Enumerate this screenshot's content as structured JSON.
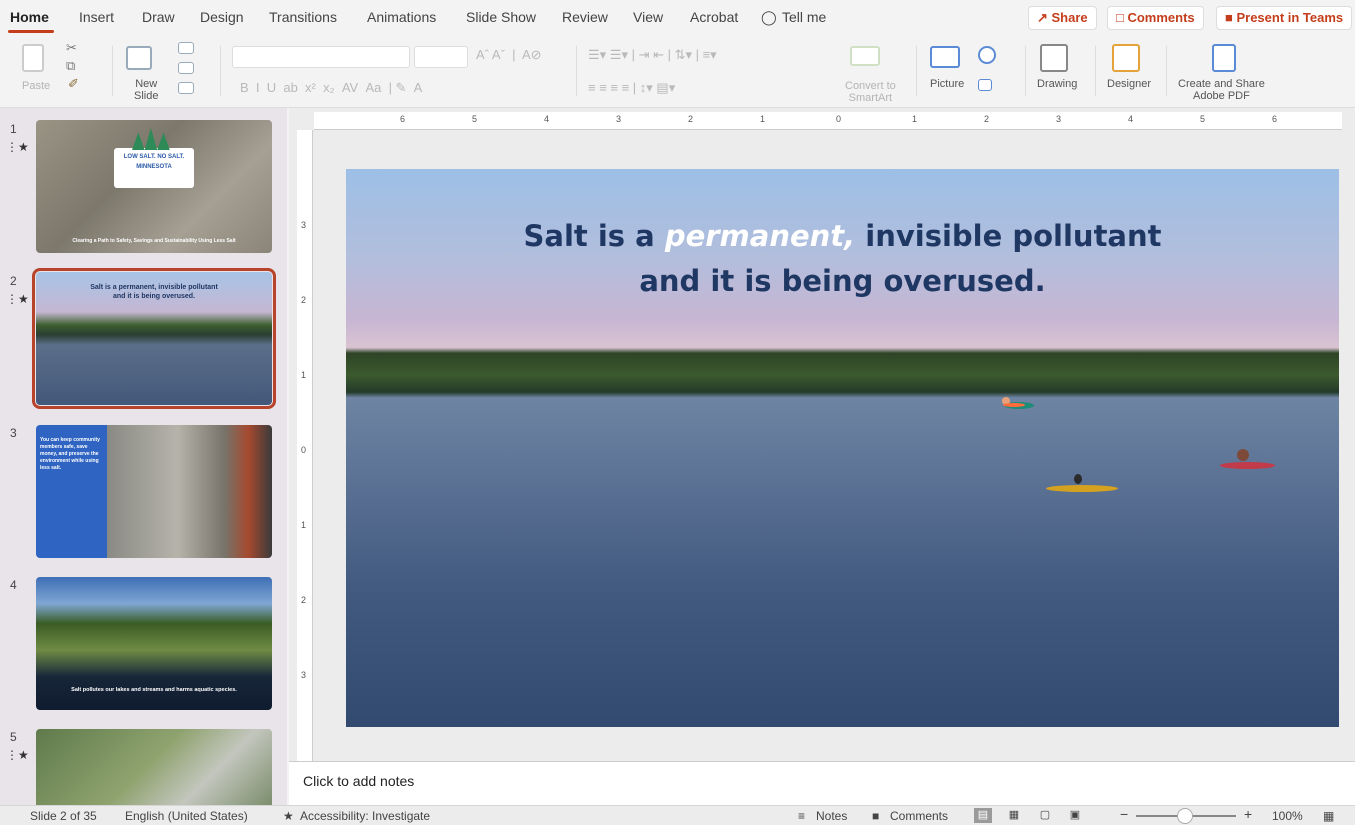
{
  "tabs": [
    "Home",
    "Insert",
    "Draw",
    "Design",
    "Transitions",
    "Animations",
    "Slide Show",
    "Review",
    "View",
    "Acrobat",
    "Tell me"
  ],
  "top_buttons": {
    "share": "Share",
    "comments": "Comments",
    "present": "Present in Teams"
  },
  "ribbon": {
    "paste": "Paste",
    "new_slide_line1": "New",
    "new_slide_line2": "Slide",
    "convert_line1": "Convert to",
    "convert_line2": "SmartArt",
    "picture": "Picture",
    "drawing": "Drawing",
    "designer": "Designer",
    "adobe_line1": "Create and Share",
    "adobe_line2": "Adobe PDF"
  },
  "thumbnails": {
    "t1": {
      "number": "1",
      "logo_line1": "LOW SALT. NO SALT.",
      "logo_line2": "MINNESOTA",
      "caption": "Clearing a Path to Safety, Savings and Sustainability Using Less Salt"
    },
    "t2": {
      "number": "2",
      "line1": "Salt is a permanent, invisible pollutant",
      "line2": "and it is being overused."
    },
    "t3": {
      "number": "3",
      "text": "You can keep community members safe, save money, and preserve the environment while using less salt."
    },
    "t4": {
      "number": "4",
      "caption": "Salt pollutes our lakes and streams and harms aquatic species."
    },
    "t5": {
      "number": "5"
    }
  },
  "slide": {
    "title_part1": "Salt is a ",
    "title_emphasis": "permanent,",
    "title_part2": " invisible pollutant",
    "title_line2": "and it is being overused."
  },
  "notes_placeholder": "Click to add notes",
  "status_bar": {
    "slide_counter": "Slide 2 of 35",
    "language": "English (United States)",
    "accessibility": "Accessibility: Investigate",
    "notes": "Notes",
    "comments": "Comments",
    "zoom": "100%"
  },
  "colors": {
    "accent": "#c43e1c",
    "slide_title": "#1f3763"
  }
}
